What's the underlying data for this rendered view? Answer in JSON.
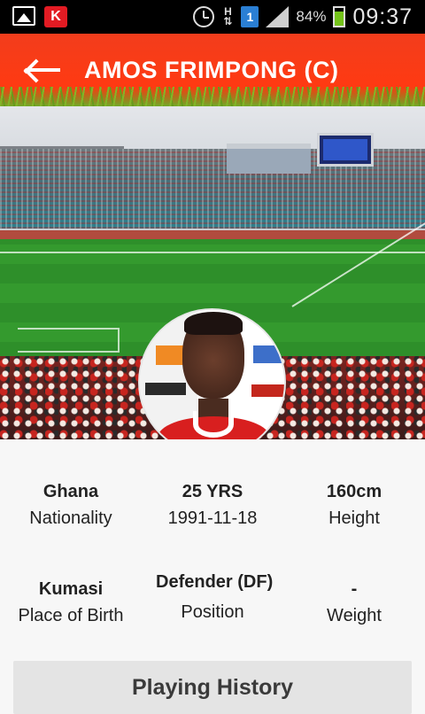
{
  "status_bar": {
    "h_indicator": "H",
    "sim_slot": "1",
    "battery_percent": "84%",
    "time": "09:37",
    "icons": [
      "gallery-icon",
      "app-icon",
      "alarm-icon",
      "network-h-icon",
      "sim-icon",
      "signal-icon",
      "battery-icon"
    ],
    "app_icon_letter": "K",
    "battery_level": 0.84
  },
  "header": {
    "title": "AMOS FRIMPONG (C)",
    "back_icon": "arrow-left-icon",
    "background_color": "#ff3a12"
  },
  "profile": {
    "nationality": {
      "value": "Ghana",
      "label": "Nationality"
    },
    "age": {
      "value": "25 YRS",
      "label": "1991-11-18"
    },
    "height": {
      "value": "160cm",
      "label": "Height"
    },
    "place_of_birth": {
      "value": "Kumasi",
      "label": "Place of Birth"
    },
    "position": {
      "value": "Defender (DF)",
      "label": "Position"
    },
    "weight": {
      "value": "-",
      "label": "Weight"
    }
  },
  "playing_history": {
    "label": "Playing History"
  }
}
